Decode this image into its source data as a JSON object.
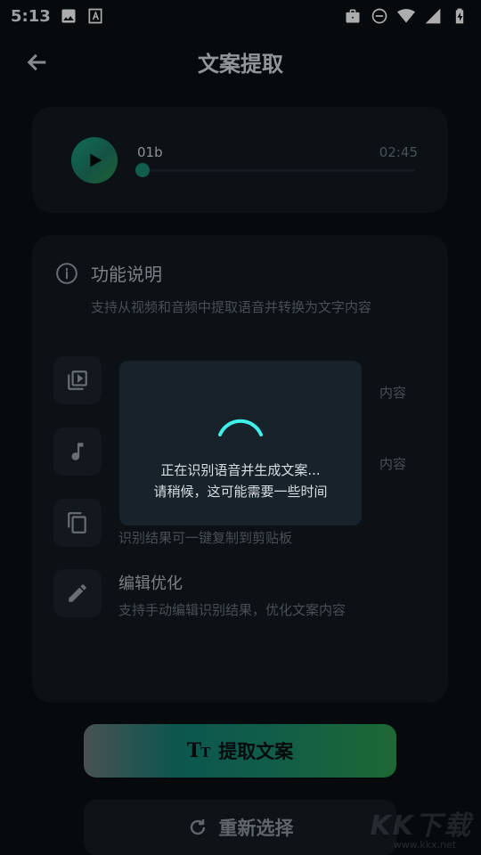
{
  "status_bar": {
    "time": "5:13",
    "icons": [
      "image-icon",
      "font-icon",
      "briefcase-icon",
      "dnd-icon",
      "wifi-icon",
      "signal-icon",
      "battery-charging-icon"
    ]
  },
  "app_bar": {
    "title": "文案提取",
    "back_icon": "arrow-left-icon"
  },
  "player": {
    "track_name": "01b",
    "duration": "02:45",
    "progress": 0.0,
    "accent": "#1a8a73"
  },
  "features": {
    "heading": "功能说明",
    "description": "支持从视频和音频中提取语音并转换为文字内容",
    "items": [
      {
        "icon": "video-library-icon",
        "title": "",
        "subtitle": "内容"
      },
      {
        "icon": "music-note-icon",
        "title": "",
        "subtitle": "内容"
      },
      {
        "icon": "copy-icon",
        "title": "",
        "subtitle": "识别结果可一键复制到剪贴板"
      },
      {
        "icon": "edit-pencil-icon",
        "title": "编辑优化",
        "subtitle": "支持手动编辑识别结果，优化文案内容"
      }
    ]
  },
  "buttons": {
    "extract_label": "提取文案",
    "extract_icon": "text-size-icon",
    "reselect_label": "重新选择",
    "reselect_icon": "refresh-icon"
  },
  "dialog": {
    "line1": "正在识别语音并生成文案...",
    "line2": "请稍候，这可能需要一些时间",
    "spinner_color": "#3ff2e8"
  },
  "watermark": {
    "text": "KK下载",
    "url": "www.kkx.net"
  }
}
